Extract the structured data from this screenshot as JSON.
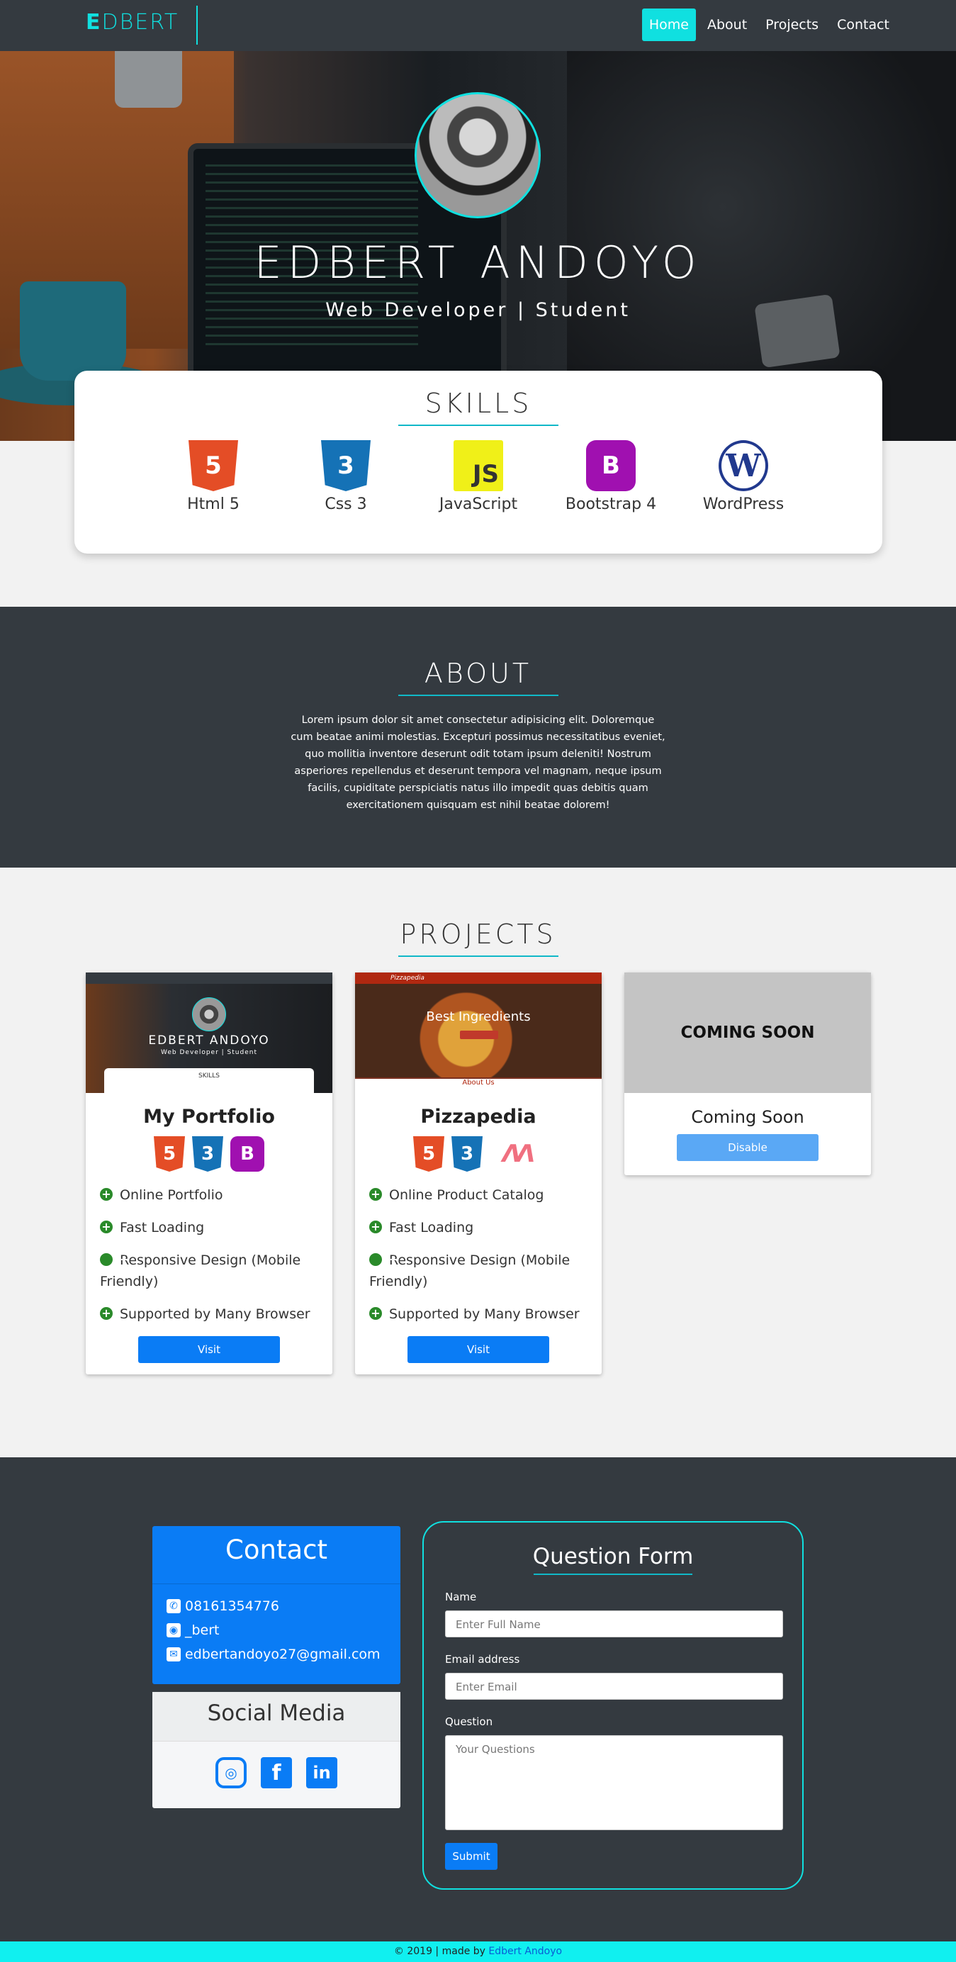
{
  "nav": {
    "brand": "EDBERT",
    "brand_first": "E",
    "brand_rest": "DBERT",
    "links": [
      "Home",
      "About",
      "Projects",
      "Contact"
    ],
    "active": "Home"
  },
  "hero": {
    "title": "EDBERT ANDOYO",
    "subtitle": "Web Developer | Student"
  },
  "skills": {
    "title": "SKILLS",
    "items": [
      {
        "label": "Html 5",
        "glyph": "5",
        "icon": "html5-icon"
      },
      {
        "label": "Css 3",
        "glyph": "3",
        "icon": "css3-icon"
      },
      {
        "label": "JavaScript",
        "glyph": "JS",
        "icon": "javascript-icon"
      },
      {
        "label": "Bootstrap 4",
        "glyph": "B",
        "icon": "bootstrap-icon"
      },
      {
        "label": "WordPress",
        "glyph": "W",
        "icon": "wordpress-icon"
      }
    ]
  },
  "about": {
    "title": "ABOUT",
    "text": "Lorem ipsum dolor sit amet consectetur adipisicing elit. Doloremque cum beatae animi molestias. Excepturi possimus necessitatibus eveniet, quo mollitia inventore deserunt odit totam ipsum deleniti! Nostrum asperiores repellendus et deserunt tempora vel magnam, neque ipsum facilis, cupiditate perspiciatis natus illo impedit quas debitis quam exercitationem quisquam est nihil beatae dolorem!"
  },
  "projects": {
    "title": "PROJECTS",
    "portfolio": {
      "name": "My Portfolio",
      "thumb_title": "EDBERT ANDOYO",
      "thumb_sub": "Web Developer | Student",
      "thumb_card": "SKILLS",
      "features": [
        "Online Portfolio",
        "Fast Loading",
        "Responsive Design (Mobile Friendly)",
        "Supported by Many Browser"
      ],
      "button": "Visit"
    },
    "pizzapedia": {
      "name": "Pizzapedia",
      "thumb_brand": "Pizzapedia",
      "thumb_text": "Best Ingredients",
      "thumb_section": "About Us",
      "features": [
        "Online Product Catalog",
        "Fast Loading",
        "Responsive Design (Mobile Friendly)",
        "Supported by Many Browser"
      ],
      "button": "Visit"
    },
    "soon": {
      "thumb_text": "COMING SOON",
      "name": "Coming Soon",
      "button": "Disable"
    }
  },
  "contact": {
    "title": "Contact",
    "phone": "08161354776",
    "line": "_bert",
    "email": "edbertandoyo27@gmail.com",
    "social_title": "Social Media",
    "social": [
      "instagram-icon",
      "facebook-icon",
      "linkedin-icon"
    ]
  },
  "form": {
    "title": "Question Form",
    "name_label": "Name",
    "name_placeholder": "Enter Full Name",
    "email_label": "Email address",
    "email_placeholder": "Enter Email",
    "question_label": "Question",
    "question_placeholder": "Your Questions",
    "submit": "Submit"
  },
  "footer": {
    "text": "© 2019 | made by",
    "author": "Edbert Andoyo"
  },
  "colors": {
    "accent": "#10e0e0",
    "dark": "#343a40",
    "primary": "#0a7cf5"
  }
}
